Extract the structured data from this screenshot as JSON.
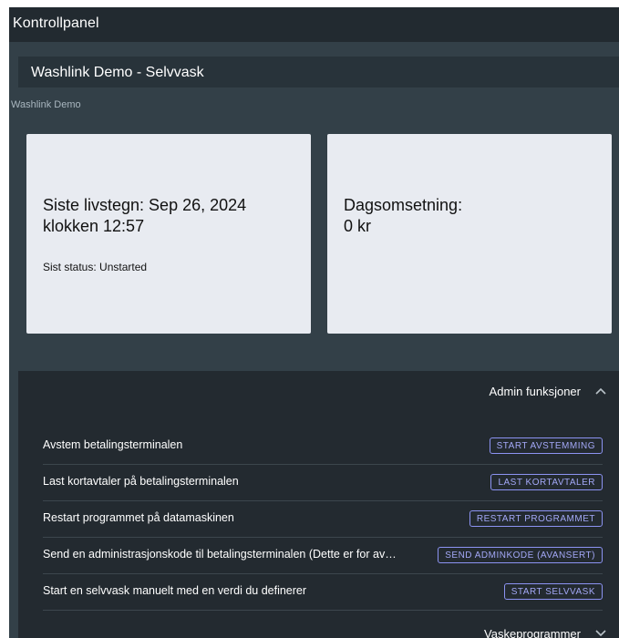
{
  "topbar": {
    "title": "Kontrollpanel"
  },
  "header": {
    "title": "Washlink Demo - Selvvask"
  },
  "breadcrumb": "Washlink Demo",
  "cards": {
    "heartbeat": {
      "line1": "Siste livstegn: Sep 26, 2024",
      "line2": "klokken 12:57",
      "status": "Sist status: Unstarted"
    },
    "revenue": {
      "line1": "Dagsomsetning:",
      "line2": "0 kr"
    }
  },
  "admin": {
    "title": "Admin funksjoner",
    "expanded_icon": "chevron-up-icon",
    "rows": [
      {
        "text": "Avstem betalingsterminalen",
        "button": "START AVSTEMMING"
      },
      {
        "text": "Last kortavtaler på betalingsterminalen",
        "button": "LAST KORTAVTALER"
      },
      {
        "text": "Restart programmet på datamaskinen",
        "button": "RESTART PROGRAMMET"
      },
      {
        "text": "Send en administrasjonskode til betalingsterminalen (Dette er for av…",
        "button": "SEND ADMINKODE (AVANSERT)"
      },
      {
        "text": "Start en selvvask manuelt med en verdi du definerer",
        "button": "START SELVVASK"
      }
    ]
  },
  "programs": {
    "title": "Vaskeprogrammer",
    "collapsed_icon": "chevron-down-icon"
  },
  "colors": {
    "background": "#334048",
    "topbar": "#222a30",
    "panel": "#232a30",
    "card": "#e8ebf1",
    "accent": "#8c93f2"
  }
}
